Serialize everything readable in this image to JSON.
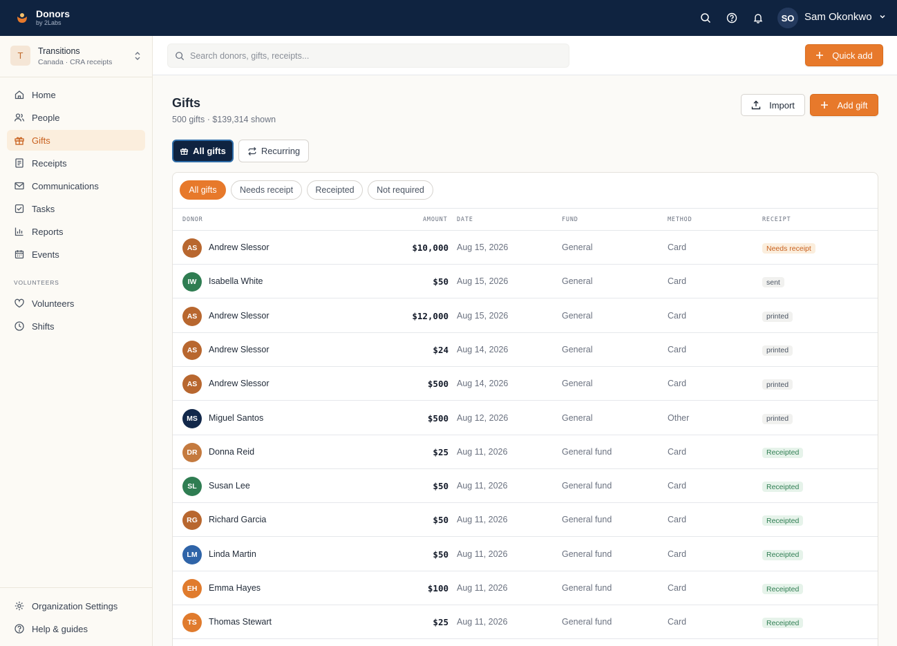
{
  "app": {
    "name": "Donors",
    "by": "by 2Labs"
  },
  "user": {
    "initials": "SO",
    "name": "Sam Okonkwo"
  },
  "org": {
    "initial": "T",
    "name": "Transitions",
    "sub": "Canada · CRA receipts"
  },
  "nav": {
    "items": [
      {
        "label": "Home",
        "icon": "home-icon"
      },
      {
        "label": "People",
        "icon": "people-icon"
      },
      {
        "label": "Gifts",
        "icon": "gift-icon",
        "active": true
      },
      {
        "label": "Receipts",
        "icon": "receipt-icon"
      },
      {
        "label": "Communications",
        "icon": "mail-icon"
      },
      {
        "label": "Tasks",
        "icon": "checkbox-icon"
      },
      {
        "label": "Reports",
        "icon": "bar-chart-icon"
      },
      {
        "label": "Events",
        "icon": "calendar-icon"
      }
    ],
    "section_label": "VOLUNTEERS",
    "volunteer_items": [
      {
        "label": "Volunteers",
        "icon": "heart-icon"
      },
      {
        "label": "Shifts",
        "icon": "clock-icon"
      }
    ],
    "bottom_items": [
      {
        "label": "Organization Settings",
        "icon": "gear-icon"
      },
      {
        "label": "Help & guides",
        "icon": "help-circle-icon"
      }
    ]
  },
  "search": {
    "placeholder": "Search donors, gifts, receipts..."
  },
  "quick_add_label": "Quick add",
  "page": {
    "title": "Gifts",
    "subtitle": "500 gifts · $139,314 shown",
    "import_label": "Import",
    "add_gift_label": "Add gift",
    "view_tabs": [
      "All gifts",
      "Recurring"
    ],
    "filters": [
      "All gifts",
      "Needs receipt",
      "Receipted",
      "Not required"
    ]
  },
  "table": {
    "columns": [
      "DONOR",
      "AMOUNT",
      "DATE",
      "FUND",
      "METHOD",
      "RECEIPT"
    ],
    "rows": [
      {
        "initials": "AS",
        "name": "Andrew Slessor",
        "amount": "$10,000",
        "date": "Aug 15, 2026",
        "fund": "General",
        "method": "Card",
        "receipt": "Needs receipt",
        "avatar_color": "#b8672f",
        "receipt_style": "needs"
      },
      {
        "initials": "IW",
        "name": "Isabella White",
        "amount": "$50",
        "date": "Aug 15, 2026",
        "fund": "General",
        "method": "Card",
        "receipt": "sent",
        "avatar_color": "#2f7d52",
        "receipt_style": "neutral"
      },
      {
        "initials": "AS",
        "name": "Andrew Slessor",
        "amount": "$12,000",
        "date": "Aug 15, 2026",
        "fund": "General",
        "method": "Card",
        "receipt": "printed",
        "avatar_color": "#b8672f",
        "receipt_style": "neutral"
      },
      {
        "initials": "AS",
        "name": "Andrew Slessor",
        "amount": "$24",
        "date": "Aug 14, 2026",
        "fund": "General",
        "method": "Card",
        "receipt": "printed",
        "avatar_color": "#b8672f",
        "receipt_style": "neutral"
      },
      {
        "initials": "AS",
        "name": "Andrew Slessor",
        "amount": "$500",
        "date": "Aug 14, 2026",
        "fund": "General",
        "method": "Card",
        "receipt": "printed",
        "avatar_color": "#b8672f",
        "receipt_style": "neutral"
      },
      {
        "initials": "MS",
        "name": "Miguel Santos",
        "amount": "$500",
        "date": "Aug 12, 2026",
        "fund": "General",
        "method": "Other",
        "receipt": "printed",
        "avatar_color": "#12284a",
        "receipt_style": "neutral"
      },
      {
        "initials": "DR",
        "name": "Donna Reid",
        "amount": "$25",
        "date": "Aug 11, 2026",
        "fund": "General fund",
        "method": "Card",
        "receipt": "Receipted",
        "avatar_color": "#c47a3f",
        "receipt_style": "ok"
      },
      {
        "initials": "SL",
        "name": "Susan Lee",
        "amount": "$50",
        "date": "Aug 11, 2026",
        "fund": "General fund",
        "method": "Card",
        "receipt": "Receipted",
        "avatar_color": "#2f7d52",
        "receipt_style": "ok"
      },
      {
        "initials": "RG",
        "name": "Richard Garcia",
        "amount": "$50",
        "date": "Aug 11, 2026",
        "fund": "General fund",
        "method": "Card",
        "receipt": "Receipted",
        "avatar_color": "#b8672f",
        "receipt_style": "ok"
      },
      {
        "initials": "LM",
        "name": "Linda Martin",
        "amount": "$50",
        "date": "Aug 11, 2026",
        "fund": "General fund",
        "method": "Card",
        "receipt": "Receipted",
        "avatar_color": "#2f64a8",
        "receipt_style": "ok"
      },
      {
        "initials": "EH",
        "name": "Emma Hayes",
        "amount": "$100",
        "date": "Aug 11, 2026",
        "fund": "General fund",
        "method": "Card",
        "receipt": "Receipted",
        "avatar_color": "#e07b2d",
        "receipt_style": "ok"
      },
      {
        "initials": "TS",
        "name": "Thomas Stewart",
        "amount": "$25",
        "date": "Aug 11, 2026",
        "fund": "General fund",
        "method": "Card",
        "receipt": "Receipted",
        "avatar_color": "#e07b2d",
        "receipt_style": "ok"
      }
    ]
  },
  "colors": {
    "navy": "#0f2340",
    "accent": "#e7792b",
    "receipted_bg": "#e6f3ea",
    "receipted_text": "#2f7d52",
    "needs_bg": "#fbeedd",
    "needs_text": "#c8601d"
  }
}
